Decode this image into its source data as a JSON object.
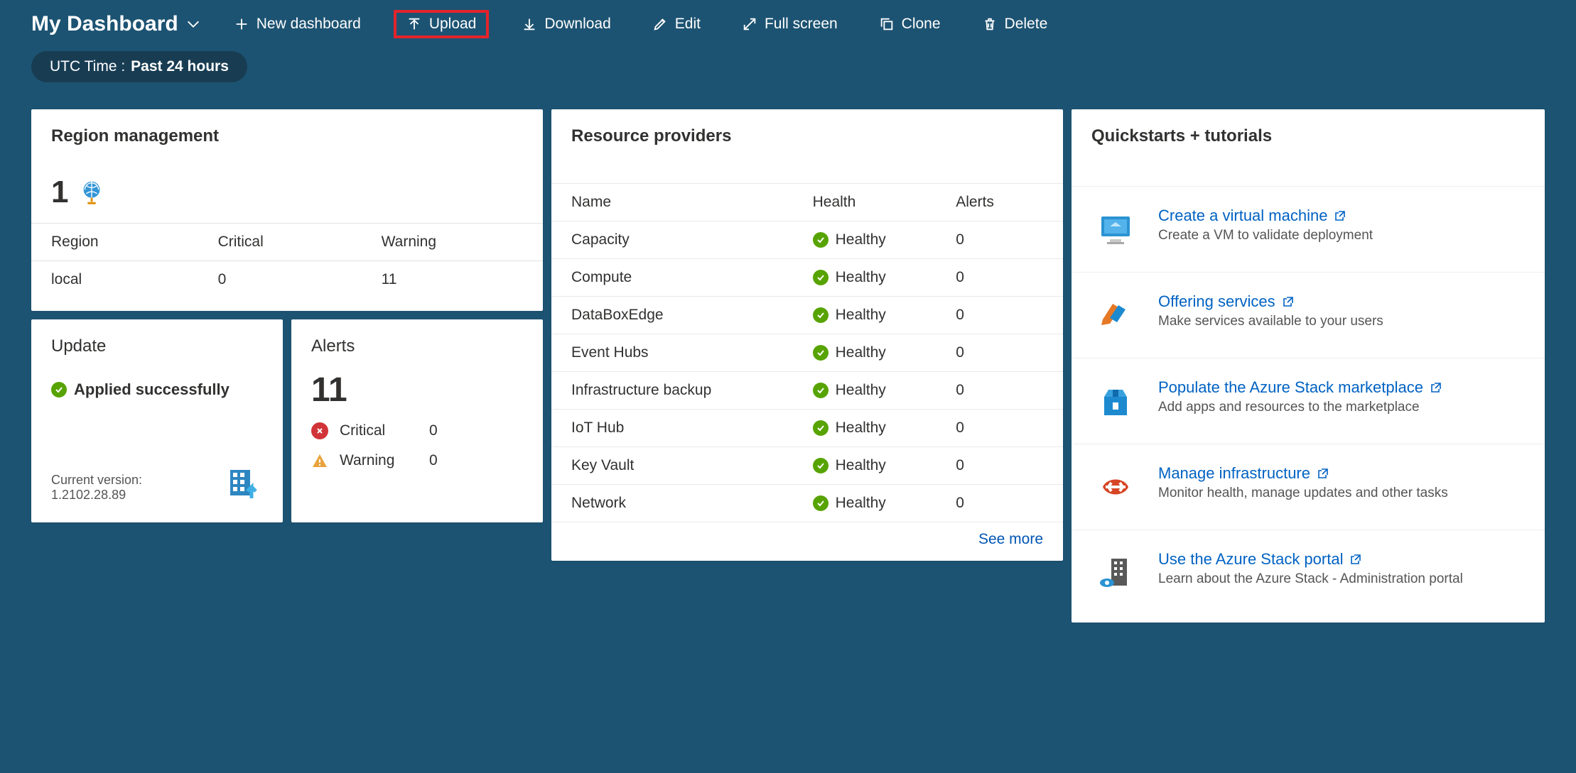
{
  "header": {
    "title": "My Dashboard",
    "new_dashboard": "New dashboard",
    "upload": "Upload",
    "download": "Download",
    "edit": "Edit",
    "full_screen": "Full screen",
    "clone": "Clone",
    "delete": "Delete"
  },
  "time_filter": {
    "label": "UTC Time :",
    "value": "Past 24 hours"
  },
  "region_mgmt": {
    "title": "Region management",
    "count": "1",
    "columns": {
      "region": "Region",
      "critical": "Critical",
      "warning": "Warning"
    },
    "row": {
      "region": "local",
      "critical": "0",
      "warning": "11"
    }
  },
  "update": {
    "title": "Update",
    "applied": "Applied successfully",
    "version_label": "Current version:",
    "version_value": "1.2102.28.89"
  },
  "alerts": {
    "title": "Alerts",
    "total": "11",
    "critical_label": "Critical",
    "critical_value": "0",
    "warning_label": "Warning",
    "warning_value": "0"
  },
  "resource_providers": {
    "title": "Resource providers",
    "columns": {
      "name": "Name",
      "health": "Health",
      "alerts": "Alerts"
    },
    "health_text": "Healthy",
    "rows": [
      {
        "name": "Capacity",
        "alerts": "0"
      },
      {
        "name": "Compute",
        "alerts": "0"
      },
      {
        "name": "DataBoxEdge",
        "alerts": "0"
      },
      {
        "name": "Event Hubs",
        "alerts": "0"
      },
      {
        "name": "Infrastructure backup",
        "alerts": "0"
      },
      {
        "name": "IoT Hub",
        "alerts": "0"
      },
      {
        "name": "Key Vault",
        "alerts": "0"
      },
      {
        "name": "Network",
        "alerts": "0"
      }
    ],
    "see_more": "See more"
  },
  "quickstarts": {
    "title": "Quickstarts + tutorials",
    "items": [
      {
        "title": "Create a virtual machine",
        "desc": "Create a VM to validate deployment"
      },
      {
        "title": "Offering services",
        "desc": "Make services available to your users"
      },
      {
        "title": "Populate the Azure Stack marketplace",
        "desc": "Add apps and resources to the marketplace"
      },
      {
        "title": "Manage infrastructure",
        "desc": "Monitor health, manage updates and other tasks"
      },
      {
        "title": "Use the Azure Stack portal",
        "desc": "Learn about the Azure Stack - Administration portal"
      }
    ]
  }
}
